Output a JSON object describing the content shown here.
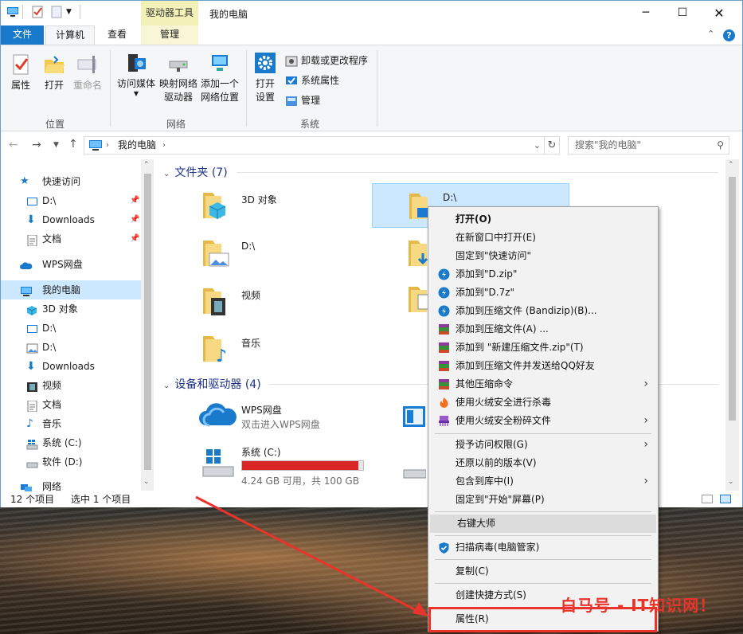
{
  "window": {
    "title": "我的电脑",
    "context_tab": "驱动器工具"
  },
  "tabs": {
    "file": "文件",
    "computer": "计算机",
    "view": "查看",
    "manage": "管理"
  },
  "ribbon": {
    "properties": "属性",
    "open": "打开",
    "rename": "重命名",
    "access_media": "访问媒体",
    "map_drive_1": "映射网络",
    "map_drive_2": "驱动器",
    "add_loc_1": "添加一个",
    "add_loc_2": "网络位置",
    "open_settings_1": "打开",
    "open_settings_2": "设置",
    "uninstall": "卸载或更改程序",
    "sys_props": "系统属性",
    "manage": "管理",
    "group_location": "位置",
    "group_network": "网络",
    "group_system": "系统"
  },
  "nav": {
    "address": "我的电脑",
    "search_placeholder": "搜索\"我的电脑\""
  },
  "sidebar": {
    "items": [
      {
        "label": "快速访问"
      },
      {
        "label": "D:\\"
      },
      {
        "label": "Downloads"
      },
      {
        "label": "文档"
      },
      {
        "label": "WPS网盘"
      },
      {
        "label": "我的电脑"
      },
      {
        "label": "3D 对象"
      },
      {
        "label": "D:\\"
      },
      {
        "label": "D:\\"
      },
      {
        "label": "Downloads"
      },
      {
        "label": "视频"
      },
      {
        "label": "文档"
      },
      {
        "label": "音乐"
      },
      {
        "label": "系统 (C:)"
      },
      {
        "label": "软件 (D:)"
      },
      {
        "label": "网络"
      }
    ]
  },
  "content": {
    "folders_header": "文件夹 (7)",
    "folders": [
      {
        "label": "3D 对象"
      },
      {
        "label": "D:\\"
      },
      {
        "label": "D:\\"
      },
      {
        "label": "视频"
      },
      {
        "label": "音乐"
      }
    ],
    "devices_header": "设备和驱动器 (4)",
    "wps": {
      "label": "WPS网盘",
      "sub": "双击进入WPS网盘"
    },
    "c_drive": {
      "label": "系统 (C:)",
      "free": "4.24 GB 可用，共 100 GB",
      "used_fraction": 0.958
    }
  },
  "status": {
    "count": "12 个项目",
    "selected": "选中 1 个项目"
  },
  "menu": {
    "items": [
      "打开(O)",
      "在新窗口中打开(E)",
      "固定到\"快速访问\"",
      "添加到\"D.zip\"",
      "添加到\"D.7z\"",
      "添加到压缩文件 (Bandizip)(B)...",
      "添加到压缩文件(A) ...",
      "添加到 \"新建压缩文件.zip\"(T)",
      "添加到压缩文件并发送给QQ好友",
      "其他压缩命令",
      "使用火绒安全进行杀毒",
      "使用火绒安全粉碎文件",
      "授予访问权限(G)",
      "还原以前的版本(V)",
      "包含到库中(I)",
      "固定到\"开始\"屏幕(P)",
      "右键大师",
      "扫描病毒(电脑管家)",
      "复制(C)",
      "创建快捷方式(S)",
      "属性(R)"
    ]
  },
  "watermark": "白马号 - IT知识网！",
  "colors": {
    "accent": "#1979ca",
    "selection": "#cce8ff",
    "drive_bar": "#da2626",
    "annotation": "#e8342a"
  }
}
